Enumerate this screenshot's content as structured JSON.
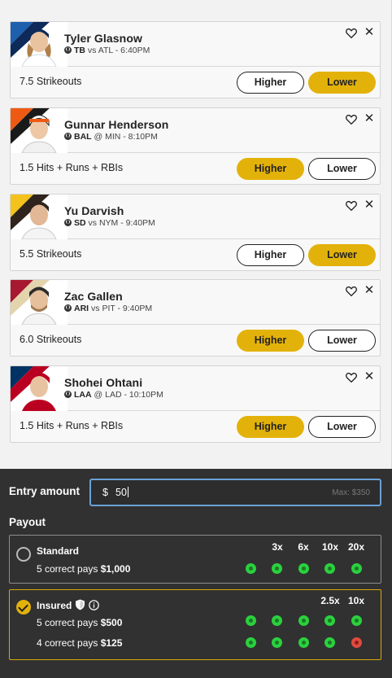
{
  "picks": [
    {
      "name": "Tyler Glasnow",
      "team": "TB",
      "sep": "vs",
      "opp": "ATL - 6:40PM",
      "stat": "7.5 Strikeouts",
      "higher": "Higher",
      "lower": "Lower",
      "selected": "lower",
      "colors": [
        "#1e5fae",
        "#0d2a5a"
      ]
    },
    {
      "name": "Gunnar Henderson",
      "team": "BAL",
      "sep": "@",
      "opp": "MIN - 8:10PM",
      "stat": "1.5 Hits + Runs + RBIs",
      "higher": "Higher",
      "lower": "Lower",
      "selected": "higher",
      "colors": [
        "#ef5a13",
        "#1a1a1a"
      ]
    },
    {
      "name": "Yu Darvish",
      "team": "SD",
      "sep": "vs",
      "opp": "NYM - 9:40PM",
      "stat": "5.5 Strikeouts",
      "higher": "Higher",
      "lower": "Lower",
      "selected": "lower",
      "colors": [
        "#f4c21c",
        "#2f241d"
      ]
    },
    {
      "name": "Zac Gallen",
      "team": "ARI",
      "sep": "vs",
      "opp": "PIT - 9:40PM",
      "stat": "6.0 Strikeouts",
      "higher": "Higher",
      "lower": "Lower",
      "selected": "higher",
      "colors": [
        "#a71930",
        "#e3d4ad"
      ]
    },
    {
      "name": "Shohei Ohtani",
      "team": "LAA",
      "sep": "@",
      "opp": "LAD - 10:10PM",
      "stat": "1.5 Hits + Runs + RBIs",
      "higher": "Higher",
      "lower": "Lower",
      "selected": "higher",
      "colors": [
        "#003263",
        "#ba0021"
      ]
    }
  ],
  "entry": {
    "label": "Entry amount",
    "currency": "$",
    "value": "50",
    "max": "Max: $350"
  },
  "payout": {
    "label": "Payout",
    "standard": {
      "title": "Standard",
      "line1_prefix": "5 correct pays ",
      "line1_amount": "$1,000",
      "multipliers": [
        "3x",
        "6x",
        "10x",
        "20x"
      ]
    },
    "insured": {
      "title": "Insured",
      "line1_prefix": "5 correct pays ",
      "line1_amount": "$500",
      "line2_prefix": "4 correct pays ",
      "line2_amount": "$125",
      "multipliers": [
        "2.5x",
        "10x"
      ]
    }
  },
  "icons": {
    "favorite": "heart-outline-icon",
    "remove": "close-icon",
    "shield": "shield-icon",
    "info": "info-icon",
    "sport": "baseball-icon"
  },
  "accent": "#e3b20a",
  "input_focus": "#6aa2d8"
}
